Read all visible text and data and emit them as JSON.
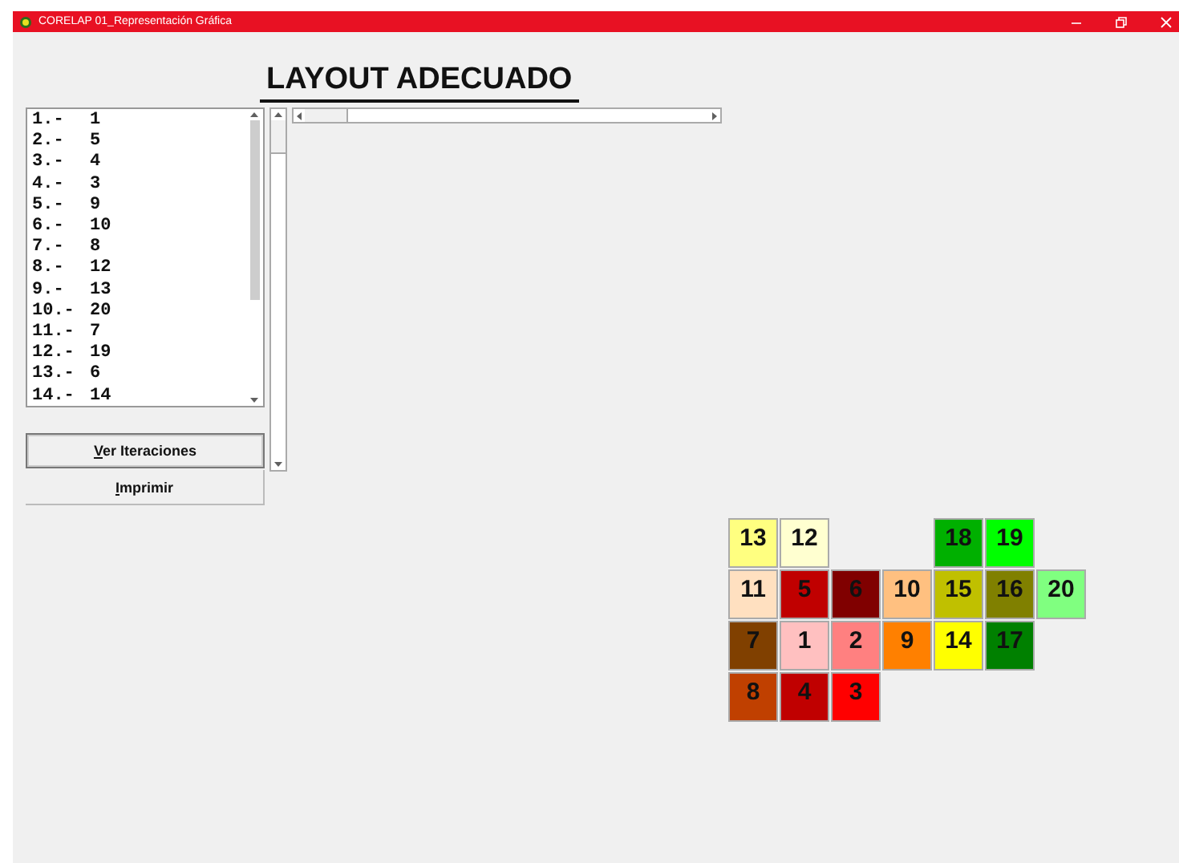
{
  "window": {
    "title": "CORELAP 01_Representación Gráfica"
  },
  "heading": "LAYOUT ADECUADO",
  "list": {
    "items": [
      {
        "index": "1.-",
        "value": "1"
      },
      {
        "index": "2.-",
        "value": "5"
      },
      {
        "index": "3.-",
        "value": "4"
      },
      {
        "index": "4.-",
        "value": "3"
      },
      {
        "index": "5.-",
        "value": "9"
      },
      {
        "index": "6.-",
        "value": "10"
      },
      {
        "index": "7.-",
        "value": "8"
      },
      {
        "index": "8.-",
        "value": "12"
      },
      {
        "index": "9.-",
        "value": "13"
      },
      {
        "index": "10.-",
        "value": "20"
      },
      {
        "index": "11.-",
        "value": "7"
      },
      {
        "index": "12.-",
        "value": "19"
      },
      {
        "index": "13.-",
        "value": "6"
      },
      {
        "index": "14.-",
        "value": "14"
      }
    ]
  },
  "buttons": [
    {
      "label": "Ver Iteraciones",
      "focused": true
    },
    {
      "label": "Imprimir",
      "focused": false
    }
  ],
  "layout_grid": [
    [
      {
        "kind": "department",
        "label": "13",
        "color": "#ffff80"
      },
      {
        "kind": "department",
        "label": "12",
        "color": "#ffffd0"
      },
      {
        "kind": "empty"
      },
      {
        "kind": "empty"
      },
      {
        "kind": "department",
        "label": "18",
        "color": "#00b000"
      },
      {
        "kind": "department",
        "label": "19",
        "color": "#00ff00"
      },
      {
        "kind": "empty"
      }
    ],
    [
      {
        "kind": "department",
        "label": "11",
        "color": "#ffe0c0"
      },
      {
        "kind": "department",
        "label": "5",
        "color": "#c00000"
      },
      {
        "kind": "department",
        "label": "6",
        "color": "#800000"
      },
      {
        "kind": "department",
        "label": "10",
        "color": "#ffc080"
      },
      {
        "kind": "department",
        "label": "15",
        "color": "#c0c000"
      },
      {
        "kind": "department",
        "label": "16",
        "color": "#808000"
      },
      {
        "kind": "department",
        "label": "20",
        "color": "#80ff80"
      }
    ],
    [
      {
        "kind": "department",
        "label": "7",
        "color": "#804000"
      },
      {
        "kind": "department",
        "label": "1",
        "color": "#ffc0c0"
      },
      {
        "kind": "department",
        "label": "2",
        "color": "#ff8080"
      },
      {
        "kind": "department",
        "label": "9",
        "color": "#ff8000"
      },
      {
        "kind": "department",
        "label": "14",
        "color": "#ffff00"
      },
      {
        "kind": "department",
        "label": "17",
        "color": "#008000"
      },
      {
        "kind": "empty"
      }
    ],
    [
      {
        "kind": "department",
        "label": "8",
        "color": "#c04000"
      },
      {
        "kind": "department",
        "label": "4",
        "color": "#c00000"
      },
      {
        "kind": "department",
        "label": "3",
        "color": "#ff0000"
      },
      {
        "kind": "empty"
      },
      {
        "kind": "empty"
      },
      {
        "kind": "empty"
      },
      {
        "kind": "empty"
      }
    ]
  ]
}
